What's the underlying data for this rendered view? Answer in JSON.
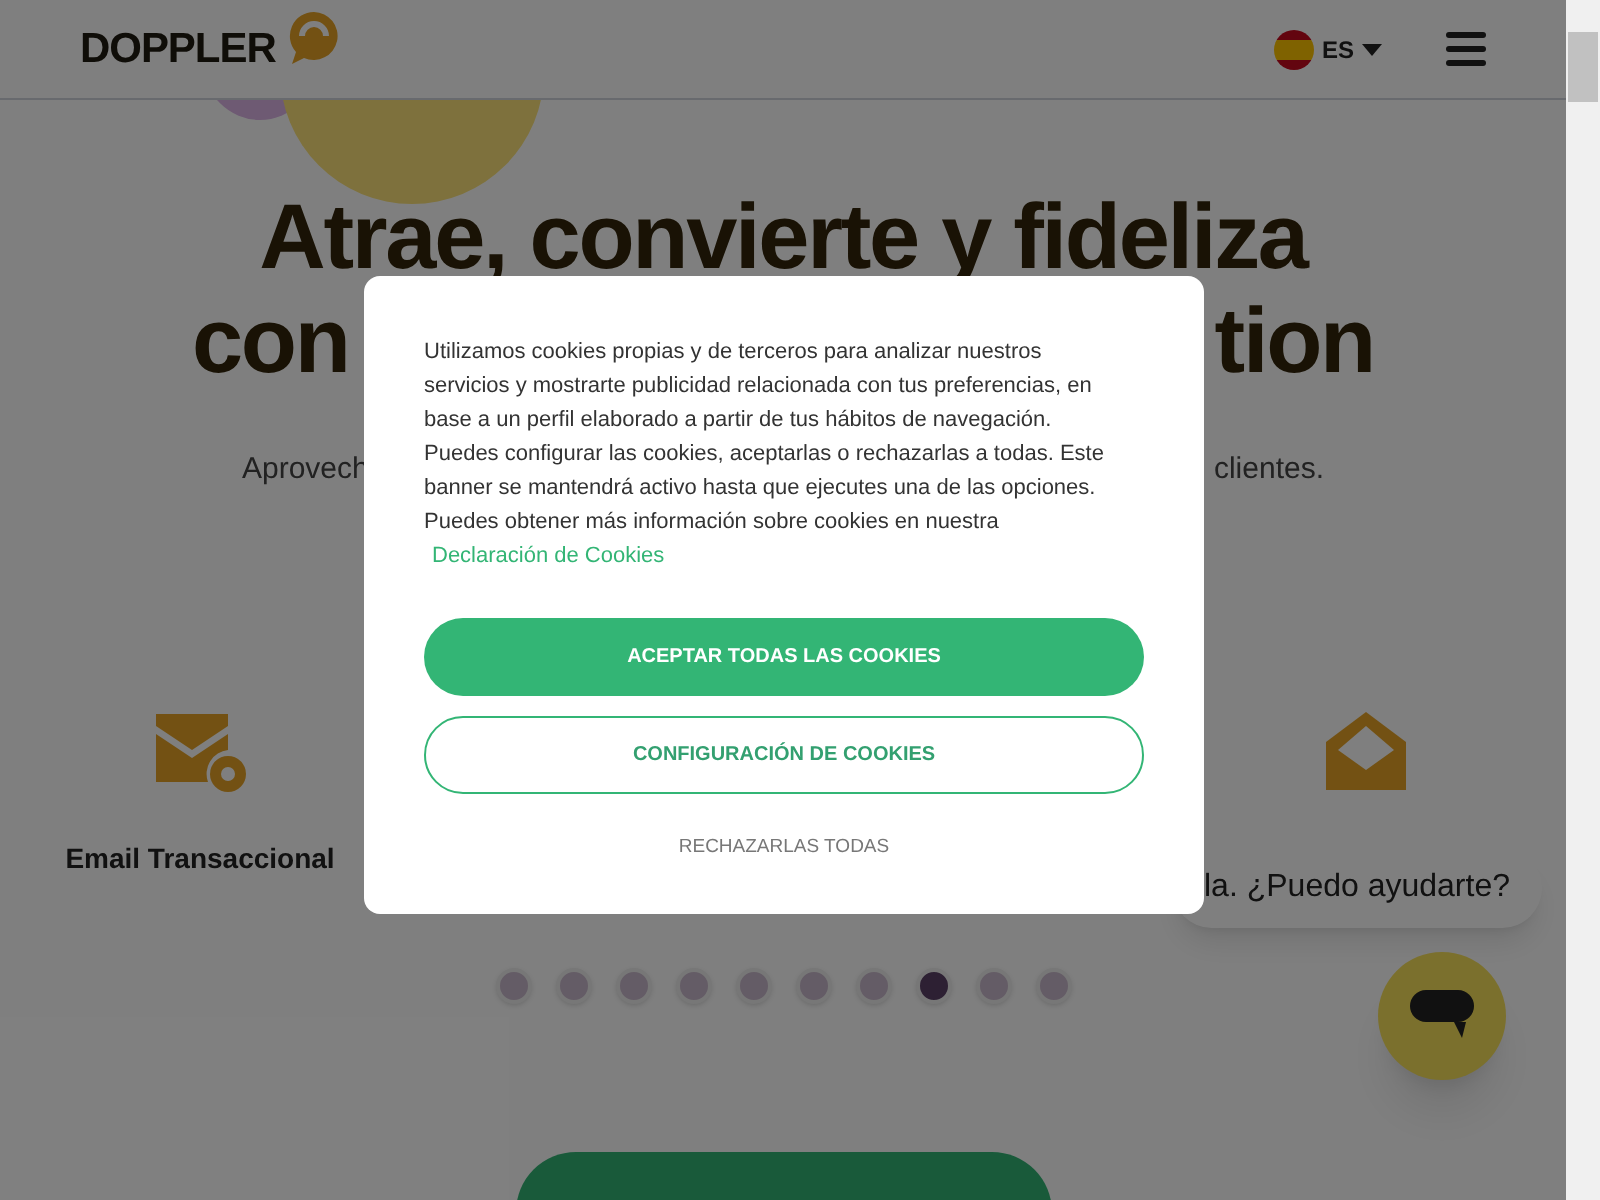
{
  "header": {
    "logo": "DOPPLER",
    "language": "ES"
  },
  "hero": {
    "title": "Atrae, convierte y fideliza",
    "title_line2_left": "con",
    "title_line2_right": "tion",
    "subtitle_left": "Aprovech",
    "subtitle_right": "clientes."
  },
  "features": [
    {
      "kind": "transactional",
      "label": "Email Transaccional"
    },
    {
      "kind": "envelope"
    }
  ],
  "carousel": [
    {
      "selected": false
    },
    {
      "selected": false
    },
    {
      "selected": false
    },
    {
      "selected": false
    },
    {
      "selected": false
    },
    {
      "selected": false
    },
    {
      "selected": false
    },
    {
      "selected": true
    },
    {
      "selected": false
    },
    {
      "selected": false
    }
  ],
  "chat": {
    "bubble": "la. ¿Puedo ayudarte?"
  },
  "cookie_dialog": {
    "text": "Utilizamos cookies propias y de terceros para analizar nuestros servicios y mostrarte publicidad relacionada con tus preferencias, en base a un perfil elaborado a partir de tus hábitos de navegación. Puedes configurar las cookies, aceptarlas o rechazarlas a todas. Este banner se mantendrá activo hasta que ejecutes una de las opciones. Puedes obtener más información sobre cookies en nuestra",
    "link": "Declaración de Cookies",
    "accept": "ACEPTAR TODAS LAS COOKIES",
    "configure": "CONFIGURACIÓN DE COOKIES",
    "reject": "RECHAZARLAS TODAS"
  }
}
